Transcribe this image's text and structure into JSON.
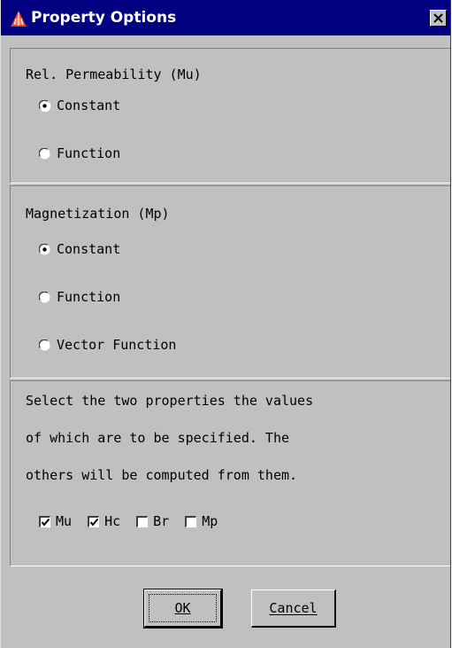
{
  "window": {
    "title": "Property Options",
    "icon": "app-triangle-icon",
    "close_icon": "close-icon",
    "title_bar_color": "#000080"
  },
  "permeability": {
    "heading": "Rel. Permeability (Mu)",
    "options": [
      {
        "label": "Constant",
        "selected": true
      },
      {
        "label": "Function",
        "selected": false
      }
    ]
  },
  "magnetization": {
    "heading": "Magnetization (Mp)",
    "options": [
      {
        "label": "Constant",
        "selected": true
      },
      {
        "label": "Function",
        "selected": false
      },
      {
        "label": "Vector Function",
        "selected": false
      }
    ]
  },
  "properties": {
    "description_lines": [
      "Select the two properties the values",
      "of which are to be specified. The",
      "others will be computed from them."
    ],
    "checkboxes": [
      {
        "label": "Mu",
        "checked": true
      },
      {
        "label": "Hc",
        "checked": true
      },
      {
        "label": "Br",
        "checked": false
      },
      {
        "label": "Mp",
        "checked": false
      }
    ]
  },
  "buttons": {
    "ok_label": "OK",
    "cancel_label": "Cancel"
  }
}
